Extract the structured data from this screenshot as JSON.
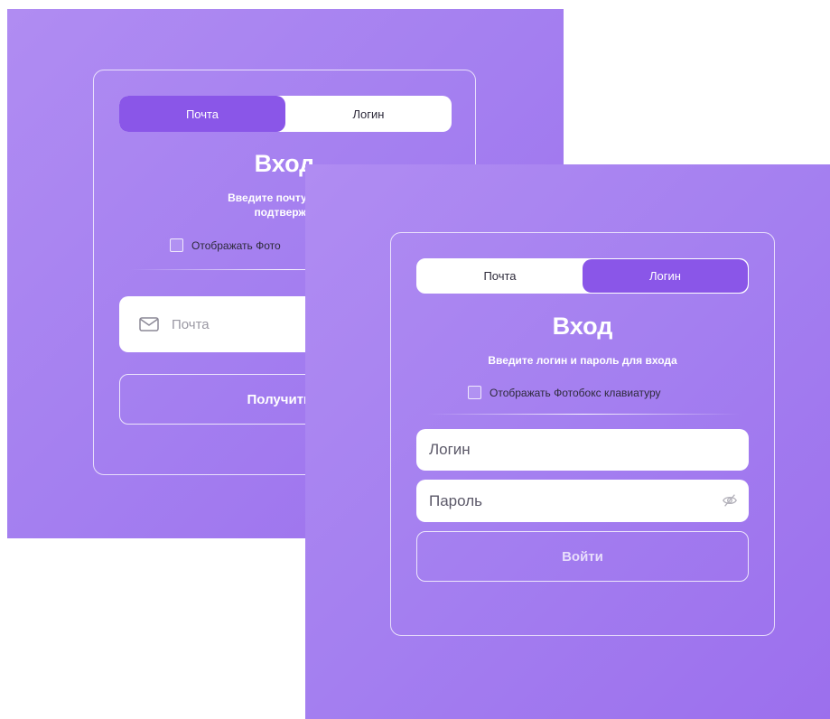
{
  "back_screen": {
    "tabs": [
      {
        "label": "Почта",
        "active": true
      },
      {
        "label": "Логин",
        "active": false
      }
    ],
    "title": "Вход",
    "subtitle_line1": "Введите почту для п",
    "subtitle_line2": "подтвержд",
    "checkbox_label": "Отображать Фото",
    "email_input": {
      "placeholder": "Почта",
      "icon": "mail-icon"
    },
    "submit_label": "Получить п"
  },
  "front_screen": {
    "tabs": [
      {
        "label": "Почта",
        "active": false
      },
      {
        "label": "Логин",
        "active": true
      }
    ],
    "title": "Вход",
    "subtitle": "Введите логин и пароль для входа",
    "checkbox_label": "Отображать Фотобокс клавиатуру",
    "login_input": {
      "placeholder": "Логин"
    },
    "password_input": {
      "placeholder": "Пароль",
      "icon": "eye-off-icon"
    },
    "submit_label": "Войти"
  },
  "colors": {
    "gradient_start": "#b08cf2",
    "gradient_end": "#9c6fed",
    "accent": "#8a56e8",
    "text_dark": "#2d2a3a"
  }
}
